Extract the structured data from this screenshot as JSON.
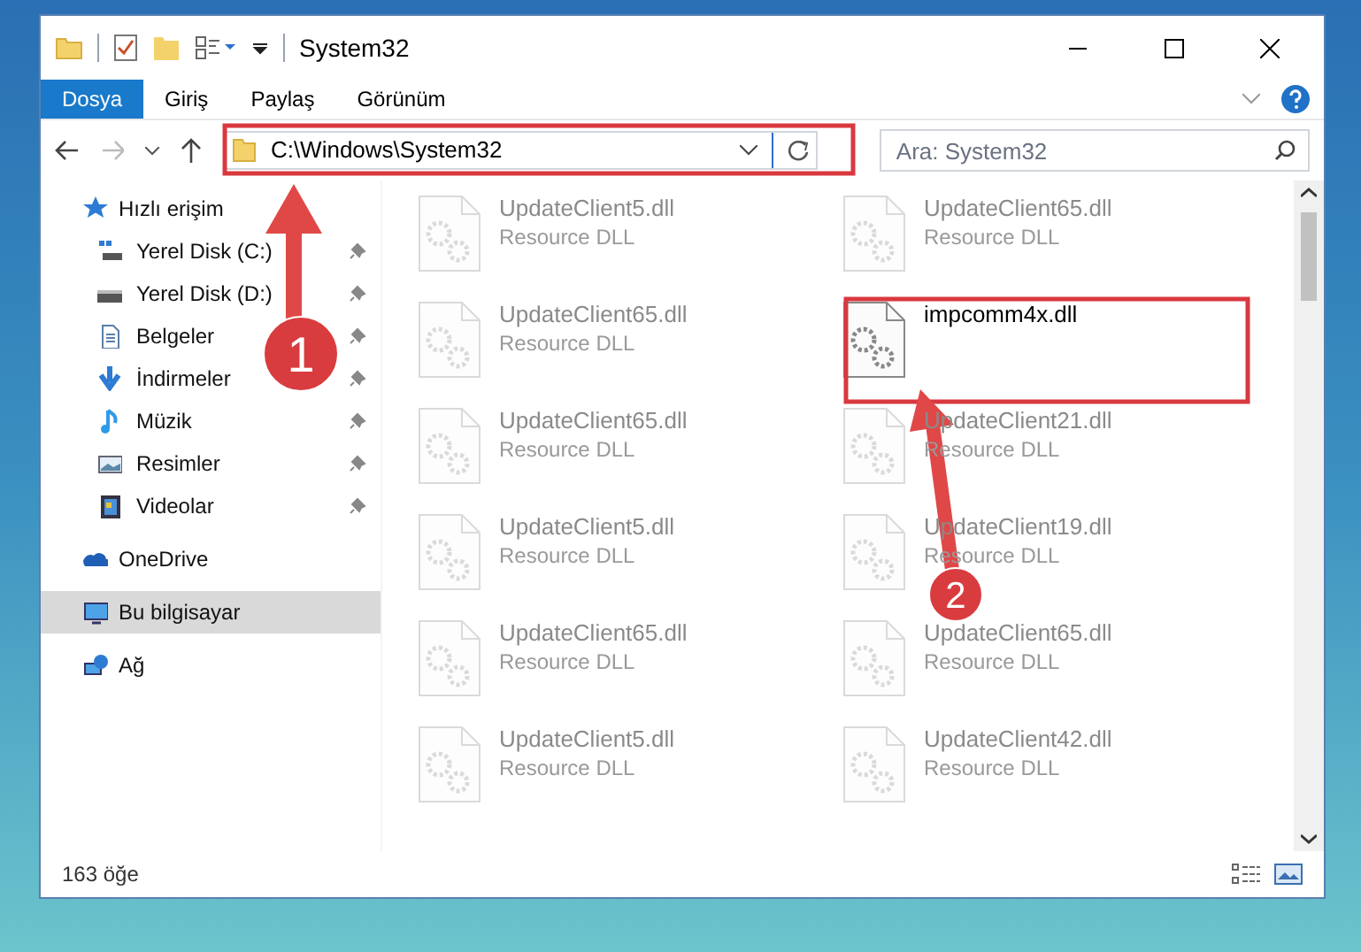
{
  "window": {
    "title": "System32"
  },
  "ribbon_tabs": [
    {
      "label": "Dosya",
      "selected": true
    },
    {
      "label": "Giriş",
      "selected": false
    },
    {
      "label": "Paylaş",
      "selected": false
    },
    {
      "label": "Görünüm",
      "selected": false
    }
  ],
  "address_bar": {
    "path": "C:\\Windows\\System32"
  },
  "search": {
    "placeholder": "Ara: System32"
  },
  "sidebar": {
    "items": [
      {
        "label": "Hızlı erişim",
        "selected": false,
        "children": [
          {
            "label": "Yerel Disk (C:)",
            "pinned": true
          },
          {
            "label": "Yerel Disk (D:)",
            "pinned": true
          },
          {
            "label": "Belgeler",
            "pinned": true
          },
          {
            "label": "İndirmeler",
            "pinned": true
          },
          {
            "label": "Müzik",
            "pinned": true
          },
          {
            "label": "Resimler",
            "pinned": true
          },
          {
            "label": "Videolar",
            "pinned": true
          }
        ]
      },
      {
        "label": "OneDrive",
        "selected": false
      },
      {
        "label": "Bu bilgisayar",
        "selected": true
      },
      {
        "label": "Ağ",
        "selected": false
      }
    ]
  },
  "files": [
    {
      "name": "UpdateClient5.dll",
      "type": "Resource DLL",
      "faded": true
    },
    {
      "name": "UpdateClient65.dll",
      "type": "Resource DLL",
      "faded": true
    },
    {
      "name": "UpdateClient65.dll",
      "type": "Resource DLL",
      "faded": true
    },
    {
      "name": "impcomm4x.dll",
      "faded": false
    },
    {
      "name": "UpdateClient65.dll",
      "type": "Resource DLL",
      "faded": true
    },
    {
      "name": "UpdateClient21.dll",
      "type": "Resource DLL",
      "faded": true
    },
    {
      "name": "UpdateClient5.dll",
      "type": "Resource DLL",
      "faded": true
    },
    {
      "name": "UpdateClient19.dll",
      "type": "Resource DLL",
      "faded": true
    },
    {
      "name": "UpdateClient65.dll",
      "type": "Resource DLL",
      "faded": true
    },
    {
      "name": "UpdateClient65.dll",
      "type": "Resource DLL",
      "faded": true
    },
    {
      "name": "UpdateClient5.dll",
      "type": "Resource DLL",
      "faded": true
    },
    {
      "name": "UpdateClient42.dll",
      "type": "Resource DLL",
      "faded": true
    }
  ],
  "status_bar": {
    "count": "163 öğe"
  },
  "annotations": [
    {
      "number": "1"
    },
    {
      "number": "2"
    }
  ]
}
